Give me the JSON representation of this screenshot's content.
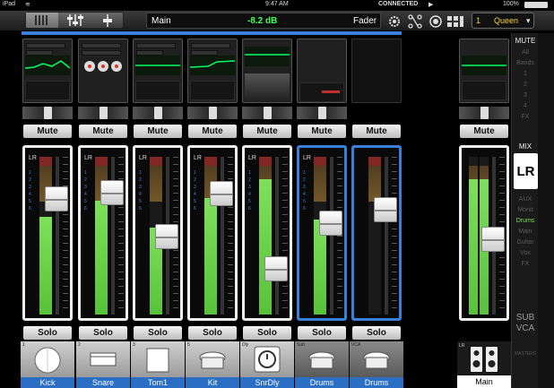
{
  "status": {
    "device": "iPad",
    "time": "9:47 AM",
    "connection": "CONNECTED",
    "battery": "100%"
  },
  "toolbar": {
    "view_name": "Main",
    "level": "-8.2 dB",
    "mode": "Fader",
    "scene_number": "1",
    "scene_name": "Queen"
  },
  "mute_label": "Mute",
  "solo_label": "Solo",
  "lr_label": "LR",
  "meter_numbers": "1\n2\n3\n4\n5\n6",
  "channels": [
    {
      "number": "1",
      "name": "Kick",
      "level": 0.62,
      "fader": 0.78
    },
    {
      "number": "2",
      "name": "Snare",
      "level": 0.72,
      "fader": 0.83
    },
    {
      "number": "3",
      "name": "Tom1",
      "level": 0.55,
      "fader": 0.5
    },
    {
      "number": "5",
      "name": "Kit",
      "level": 0.74,
      "fader": 0.82
    },
    {
      "number": "Dly",
      "name": "SnrDly",
      "level": 0.86,
      "fader": 0.26
    },
    {
      "number": "Sub",
      "name": "Drums",
      "level": 0.6,
      "fader": 0.6
    },
    {
      "number": "VCA",
      "name": "Drums",
      "level": 0.0,
      "fader": 0.7
    }
  ],
  "main": {
    "label": "LR",
    "name": "Main",
    "level": 0.86,
    "fader": 0.48
  },
  "right_panel": {
    "mute_header": "MUTE",
    "mute_items": [
      "All",
      "Bands",
      "1",
      "2",
      "3",
      "4",
      "FX"
    ],
    "mix_header": "MIX",
    "mix_selected": "LR",
    "mix_items": [
      "AUX",
      "Monit",
      "Drums",
      "Main",
      "Guitar",
      "Vox",
      "FX"
    ],
    "sub_label": "SUB",
    "vca_label": "VCA",
    "master_label": "MASTERS"
  },
  "colors": {
    "accent_blue": "#3a7fd8",
    "meter_green": "#6fd64a",
    "eq_green": "#00ff66",
    "scene_yellow": "#f5d442"
  }
}
